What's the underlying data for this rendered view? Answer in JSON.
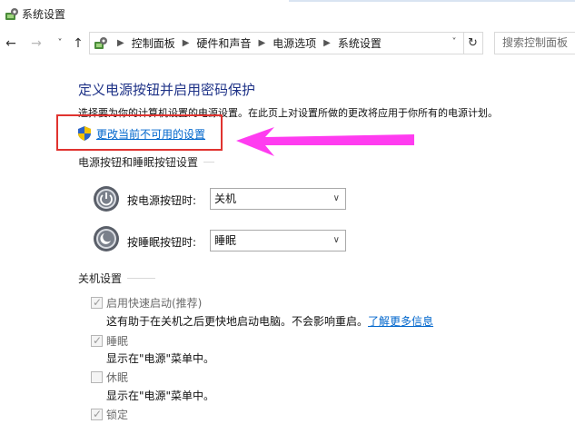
{
  "window": {
    "title": "系统设置"
  },
  "nav": {
    "back_icon": "back-arrow-icon",
    "forward_icon": "forward-arrow-icon",
    "recent_icon": "chevron-down-icon",
    "up_icon": "up-arrow-icon",
    "breadcrumbs": [
      "控制面板",
      "硬件和声音",
      "电源选项",
      "系统设置"
    ],
    "search_placeholder": "搜索控制面板"
  },
  "main": {
    "title": "定义电源按钮并启用密码保护",
    "description": "选择要为你的计算机设置的电源设置。在此页上对设置所做的更改将应用于你所有的电源计划。",
    "change_link": "更改当前不可用的设置"
  },
  "power_section": {
    "heading": "电源按钮和睡眠按钮设置",
    "rows": [
      {
        "label": "按电源按钮时:",
        "value": "关机"
      },
      {
        "label": "按睡眠按钮时:",
        "value": "睡眠"
      }
    ]
  },
  "shutdown_section": {
    "heading": "关机设置",
    "options": [
      {
        "label": "启用快速启动(推荐)",
        "checked": true,
        "desc": "这有助于在关机之后更快地启动电脑。不会影响重启。",
        "link": "了解更多信息"
      },
      {
        "label": "睡眠",
        "checked": true,
        "desc": "显示在\"电源\"菜单中。"
      },
      {
        "label": "休眠",
        "checked": false,
        "desc": "显示在\"电源\"菜单中。"
      },
      {
        "label": "锁定",
        "checked": true
      }
    ]
  },
  "colors": {
    "title_blue": "#1e3287",
    "link_blue": "#0066cc",
    "annotation_red": "#e0332f",
    "annotation_magenta": "#ff3cf0"
  }
}
